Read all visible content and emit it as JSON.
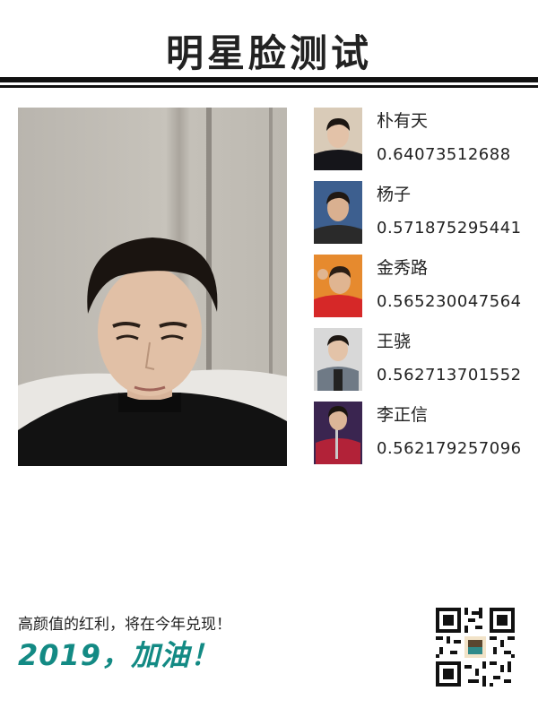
{
  "header": {
    "title": "明星脸测试"
  },
  "matches": [
    {
      "name": "朴有天",
      "score": "0.64073512688",
      "thumb_bg": "#d9cbb8",
      "thumb_cloth": "#15151a"
    },
    {
      "name": "杨子",
      "score": "0.571875295441",
      "thumb_bg": "#3d5f8f",
      "thumb_cloth": "#2a2a2a"
    },
    {
      "name": "金秀路",
      "score": "0.565230047564",
      "thumb_bg": "#e68a2e",
      "thumb_cloth": "#d62828"
    },
    {
      "name": "王骁",
      "score": "0.562713701552",
      "thumb_bg": "#d8d8d8",
      "thumb_cloth": "#6f7a86"
    },
    {
      "name": "李正信",
      "score": "0.562179257096",
      "thumb_bg": "#3a2550",
      "thumb_cloth": "#b22238"
    }
  ],
  "footer": {
    "slogan": "高颜值的红利，将在今年兑现！",
    "cheer": "2019，加油！"
  },
  "colors": {
    "accent": "#138a84",
    "text": "#222222",
    "rule": "#111111"
  },
  "icons": {
    "qr": "qr-code-icon"
  }
}
